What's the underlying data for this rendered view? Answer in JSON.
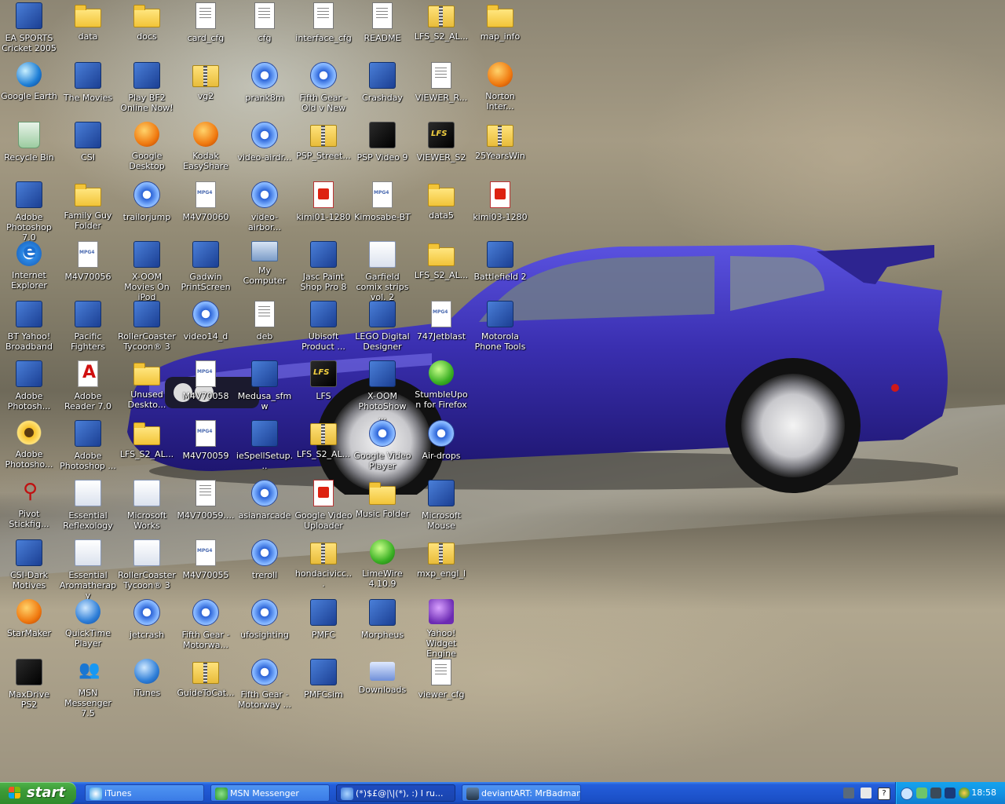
{
  "desktop": {
    "icons": [
      {
        "label": "EA SPORTS Cricket 2005",
        "icon": "cricket-icon",
        "col": 0,
        "row": 0
      },
      {
        "label": "data",
        "icon": "folder-icon",
        "col": 1,
        "row": 0
      },
      {
        "label": "docs",
        "icon": "folder-icon",
        "col": 2,
        "row": 0
      },
      {
        "label": "card_cfg",
        "icon": "document-icon",
        "col": 3,
        "row": 0
      },
      {
        "label": "cfg",
        "icon": "document-icon",
        "col": 4,
        "row": 0
      },
      {
        "label": "interface_cfg",
        "icon": "document-icon",
        "col": 5,
        "row": 0
      },
      {
        "label": "README",
        "icon": "document-icon",
        "col": 6,
        "row": 0
      },
      {
        "label": "LFS_S2_AL...",
        "icon": "zip-folder-icon",
        "col": 7,
        "row": 0
      },
      {
        "label": "map_info",
        "icon": "folder-icon",
        "col": 8,
        "row": 0
      },
      {
        "label": "Google Earth",
        "icon": "google-earth-icon",
        "col": 0,
        "row": 1
      },
      {
        "label": "The Movies",
        "icon": "the-movies-icon",
        "col": 1,
        "row": 1
      },
      {
        "label": "Play BF2 Online Now!",
        "icon": "battlefield-icon",
        "col": 2,
        "row": 1
      },
      {
        "label": "vg2",
        "icon": "zip-folder-icon",
        "col": 3,
        "row": 1
      },
      {
        "label": "prank8m",
        "icon": "video-icon",
        "col": 4,
        "row": 1
      },
      {
        "label": "Fifth Gear - Old v New",
        "icon": "video-icon",
        "col": 5,
        "row": 1
      },
      {
        "label": "Crashday",
        "icon": "crashday-icon",
        "col": 6,
        "row": 1
      },
      {
        "label": "VIEWER_R...",
        "icon": "document-icon",
        "col": 7,
        "row": 1
      },
      {
        "label": "Norton Inter...",
        "icon": "norton-icon",
        "col": 8,
        "row": 1
      },
      {
        "label": "Recycle Bin",
        "icon": "recycle-bin-icon",
        "col": 0,
        "row": 2
      },
      {
        "label": "CSI",
        "icon": "csi-icon",
        "col": 1,
        "row": 2
      },
      {
        "label": "Google Desktop",
        "icon": "google-desktop-icon",
        "col": 2,
        "row": 2
      },
      {
        "label": "Kodak EasyShare",
        "icon": "kodak-icon",
        "col": 3,
        "row": 2
      },
      {
        "label": "video-airdr...",
        "icon": "video-file-icon",
        "col": 4,
        "row": 2
      },
      {
        "label": "PSP_Street...",
        "icon": "zip-folder-icon",
        "col": 5,
        "row": 2
      },
      {
        "label": "PSP Video 9",
        "icon": "psp-video-icon",
        "col": 6,
        "row": 2
      },
      {
        "label": "VIEWER_S2",
        "icon": "lfs-icon",
        "col": 7,
        "row": 2
      },
      {
        "label": "25YearsWin",
        "icon": "zip-folder-icon",
        "col": 8,
        "row": 2
      },
      {
        "label": "Adobe Photoshop 7.0",
        "icon": "photoshop-icon",
        "col": 0,
        "row": 3
      },
      {
        "label": "Family Guy Folder",
        "icon": "folder-icon",
        "col": 1,
        "row": 3
      },
      {
        "label": "trailorjump",
        "icon": "video-icon",
        "col": 2,
        "row": 3
      },
      {
        "label": "M4V70060",
        "icon": "mpg4-icon",
        "col": 3,
        "row": 3
      },
      {
        "label": "video-airbor...",
        "icon": "video-file-icon",
        "col": 4,
        "row": 3
      },
      {
        "label": "kimi01-1280",
        "icon": "kodak-image-icon",
        "col": 5,
        "row": 3
      },
      {
        "label": "Kimosabe-BT",
        "icon": "mp3-icon",
        "col": 6,
        "row": 3
      },
      {
        "label": "data5",
        "icon": "folder-icon",
        "col": 7,
        "row": 3
      },
      {
        "label": "kimi03-1280",
        "icon": "kodak-image-icon",
        "col": 8,
        "row": 3
      },
      {
        "label": "Internet Explorer",
        "icon": "internet-explorer-icon",
        "col": 0,
        "row": 4
      },
      {
        "label": "M4V70056",
        "icon": "mpg4-icon",
        "col": 1,
        "row": 4
      },
      {
        "label": "X-OOM Movies On iPod",
        "icon": "xoom-icon",
        "col": 2,
        "row": 4
      },
      {
        "label": "Gadwin PrintScreen",
        "icon": "camera-icon",
        "col": 3,
        "row": 4
      },
      {
        "label": "My Computer",
        "icon": "my-computer-icon",
        "col": 4,
        "row": 4
      },
      {
        "label": "Jasc Paint Shop Pro 8",
        "icon": "paint-shop-pro-icon",
        "col": 5,
        "row": 4
      },
      {
        "label": "Garfield comix strips vol. 2",
        "icon": "notepad-icon",
        "col": 6,
        "row": 4
      },
      {
        "label": "LFS_S2_AL...",
        "icon": "folder-icon",
        "col": 7,
        "row": 4
      },
      {
        "label": "Battlefield 2",
        "icon": "battlefield-icon",
        "col": 8,
        "row": 4
      },
      {
        "label": "BT Yahoo! Broadband",
        "icon": "bt-yahoo-icon",
        "col": 0,
        "row": 5
      },
      {
        "label": "Pacific Fighters",
        "icon": "plane-icon",
        "col": 1,
        "row": 5
      },
      {
        "label": "RollerCoaster Tycoon® 3",
        "icon": "panda-icon",
        "col": 2,
        "row": 5
      },
      {
        "label": "video14_d",
        "icon": "video-file-icon",
        "col": 3,
        "row": 5
      },
      {
        "label": "deb",
        "icon": "document-icon",
        "col": 4,
        "row": 5
      },
      {
        "label": "Ubisoft Product ...",
        "icon": "ubisoft-icon",
        "col": 5,
        "row": 5
      },
      {
        "label": "LEGO Digital Designer",
        "icon": "lego-icon",
        "col": 6,
        "row": 5
      },
      {
        "label": "747Jetblast",
        "icon": "mpg4-icon",
        "col": 7,
        "row": 5
      },
      {
        "label": "Motorola Phone Tools",
        "icon": "motorola-icon",
        "col": 8,
        "row": 5
      },
      {
        "label": "Adobe Photosh...",
        "icon": "camera-icon",
        "col": 0,
        "row": 6
      },
      {
        "label": "Adobe Reader 7.0",
        "icon": "adobe-reader-icon",
        "col": 1,
        "row": 6
      },
      {
        "label": "Unused Deskto...",
        "icon": "folder-icon",
        "col": 2,
        "row": 6
      },
      {
        "label": "M4V70058",
        "icon": "mpg4-icon",
        "col": 3,
        "row": 6
      },
      {
        "label": "Medusa_sfmw",
        "icon": "medusa-icon",
        "col": 4,
        "row": 6
      },
      {
        "label": "LFS",
        "icon": "lfs-icon",
        "col": 5,
        "row": 6
      },
      {
        "label": "X-OOM PhotoShow ...",
        "icon": "xoom-photoshow-icon",
        "col": 6,
        "row": 6
      },
      {
        "label": "StumbleUpon for Firefox",
        "icon": "stumbleupon-icon",
        "col": 7,
        "row": 6
      },
      {
        "label": "Adobe Photosho...",
        "icon": "sunflower-icon",
        "col": 0,
        "row": 7
      },
      {
        "label": "Adobe Photoshop ...",
        "icon": "photoshop-album-icon",
        "col": 1,
        "row": 7
      },
      {
        "label": "LFS_S2_AL...",
        "icon": "folder-icon",
        "col": 2,
        "row": 7
      },
      {
        "label": "M4V70059",
        "icon": "mpg4-icon",
        "col": 3,
        "row": 7
      },
      {
        "label": "ieSpellSetup...",
        "icon": "installer-icon",
        "col": 4,
        "row": 7
      },
      {
        "label": "LFS_S2_AL...",
        "icon": "zip-folder-icon",
        "col": 5,
        "row": 7
      },
      {
        "label": "Google Video Player",
        "icon": "google-video-icon",
        "col": 6,
        "row": 7
      },
      {
        "label": "Air-drops",
        "icon": "video-icon",
        "col": 7,
        "row": 7
      },
      {
        "label": "Pivot Stickfig...",
        "icon": "stickfigure-icon",
        "col": 0,
        "row": 8
      },
      {
        "label": "Essential Reflexology",
        "icon": "reflexology-icon",
        "col": 1,
        "row": 8
      },
      {
        "label": "Microsoft Works",
        "icon": "works-icon",
        "col": 2,
        "row": 8
      },
      {
        "label": "M4V70059....",
        "icon": "text-file-icon",
        "col": 3,
        "row": 8
      },
      {
        "label": "asianarcade",
        "icon": "video-icon",
        "col": 4,
        "row": 8
      },
      {
        "label": "Google Video Uploader",
        "icon": "google-uploader-icon",
        "col": 5,
        "row": 8
      },
      {
        "label": "Music Folder",
        "icon": "music-folder-icon",
        "col": 6,
        "row": 8
      },
      {
        "label": "Microsoft Mouse",
        "icon": "mouse-icon",
        "col": 7,
        "row": 8
      },
      {
        "label": "CSI-Dark Motives",
        "icon": "csi-icon",
        "col": 0,
        "row": 9
      },
      {
        "label": "Essential Aromatherapy",
        "icon": "reflexology-icon",
        "col": 1,
        "row": 9
      },
      {
        "label": "RollerCoaster Tycoon® 3",
        "icon": "window-icon",
        "col": 2,
        "row": 9
      },
      {
        "label": "M4V70055",
        "icon": "mpg4-icon",
        "col": 3,
        "row": 9
      },
      {
        "label": "treroll",
        "icon": "video-icon",
        "col": 4,
        "row": 9
      },
      {
        "label": "hondacivicc...",
        "icon": "zip-folder-icon",
        "col": 5,
        "row": 9
      },
      {
        "label": "LimeWire 4.10.9",
        "icon": "limewire-icon",
        "col": 6,
        "row": 9
      },
      {
        "label": "mxp_engl_l",
        "icon": "zip-folder-icon",
        "col": 7,
        "row": 9
      },
      {
        "label": "StarMaker",
        "icon": "masks-icon",
        "col": 0,
        "row": 10
      },
      {
        "label": "QuickTime Player",
        "icon": "quicktime-icon",
        "col": 1,
        "row": 10
      },
      {
        "label": "jetcrash",
        "icon": "video-icon",
        "col": 2,
        "row": 10
      },
      {
        "label": "Fifth Gear - Motorwa...",
        "icon": "video-icon",
        "col": 3,
        "row": 10
      },
      {
        "label": "ufosighting",
        "icon": "video-icon",
        "col": 4,
        "row": 10
      },
      {
        "label": "PMFC",
        "icon": "pmfc-icon",
        "col": 5,
        "row": 10
      },
      {
        "label": "Morpheus",
        "icon": "morpheus-icon",
        "col": 6,
        "row": 10
      },
      {
        "label": "Yahoo! Widget Engine",
        "icon": "widget-engine-icon",
        "col": 7,
        "row": 10
      },
      {
        "label": "MaxDrive PS2",
        "icon": "maxdrive-icon",
        "col": 0,
        "row": 11
      },
      {
        "label": "MSN Messenger 7.5",
        "icon": "msn-icon",
        "col": 1,
        "row": 11
      },
      {
        "label": "iTunes",
        "icon": "itunes-icon",
        "col": 2,
        "row": 11
      },
      {
        "label": "GuideToCat...",
        "icon": "zip-folder-icon",
        "col": 3,
        "row": 11
      },
      {
        "label": "Fifth Gear - Motorway ...",
        "icon": "video-icon",
        "col": 4,
        "row": 11
      },
      {
        "label": "PMFCsim",
        "icon": "pmfc-icon",
        "col": 5,
        "row": 11
      },
      {
        "label": "Downloads",
        "icon": "downloads-icon",
        "col": 6,
        "row": 11
      },
      {
        "label": "viewer_cfg",
        "icon": "document-icon",
        "col": 7,
        "row": 11
      }
    ]
  },
  "taskbar": {
    "start_label": "start",
    "tasks": [
      {
        "label": "iTunes",
        "icon": "itunes-icon",
        "active": false
      },
      {
        "label": "MSN Messenger",
        "icon": "msn-icon",
        "active": false
      },
      {
        "label": "(*)$£@|\\|(*), :) I ru...",
        "icon": "chat-window-icon",
        "active": true
      },
      {
        "label": "deviantART: MrBadman",
        "icon": "browser-icon",
        "active": false
      }
    ],
    "clock": "18:58"
  },
  "colors": {
    "taskbar_blue": "#245edb",
    "start_green": "#3c9a37",
    "tray_blue": "#1393e4",
    "car_purple": "#3a2fb0"
  }
}
